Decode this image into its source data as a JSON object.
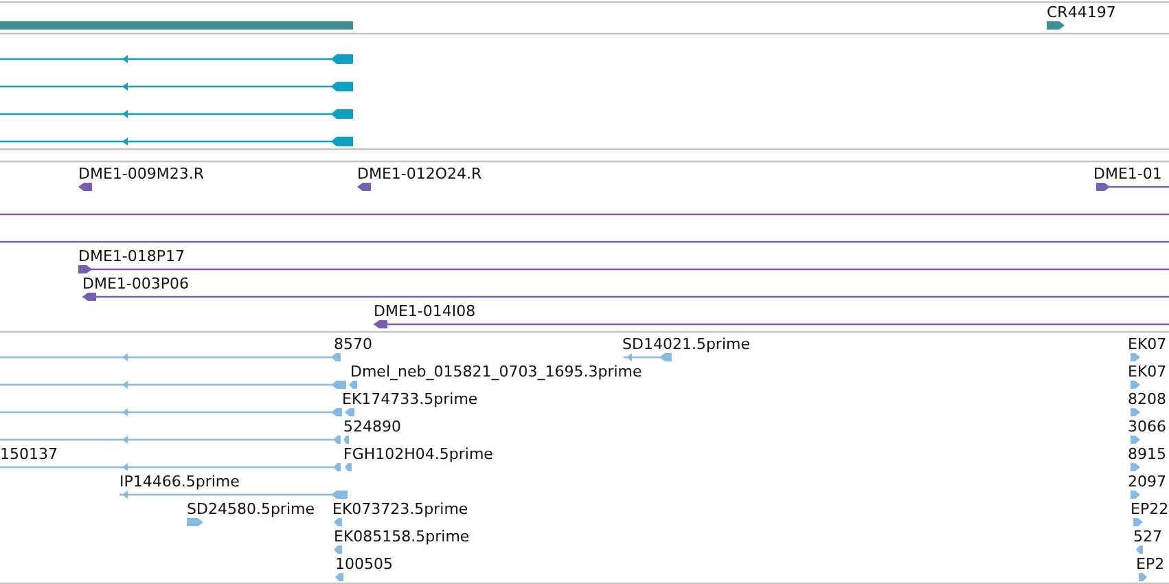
{
  "tracks": [
    {
      "color": "#3e8f92",
      "features": [
        {
          "kind": "bar"
        },
        {
          "label": "CR44197",
          "kind": "arrow",
          "reverse": false
        }
      ]
    },
    {
      "color": "#0fa0c6",
      "features": [
        {
          "kind": "arrow",
          "reverse": true
        },
        {
          "kind": "arrow",
          "reverse": true
        },
        {
          "kind": "arrow",
          "reverse": true
        },
        {
          "kind": "arrow",
          "reverse": true
        }
      ]
    },
    {
      "color": "#7a5cb0",
      "features": [
        {
          "label": "DME1-009M23.R",
          "kind": "arrow",
          "reverse": true
        },
        {
          "label": "DME1-012O24.R",
          "kind": "arrow",
          "reverse": true
        },
        {
          "label": "DME1-01",
          "kind": "arrow",
          "reverse": false
        },
        {
          "kind": "line"
        },
        {
          "kind": "line"
        },
        {
          "label": "DME1-018P17",
          "kind": "arrow",
          "reverse": false
        },
        {
          "label": "DME1-003P06",
          "kind": "arrow",
          "reverse": true
        },
        {
          "label": "DME1-014I08",
          "kind": "arrow",
          "reverse": true
        }
      ]
    },
    {
      "color": "#86bae0",
      "features": [
        {
          "label": "8570",
          "kind": "arrow",
          "reverse": true
        },
        {
          "label": "SD14021.5prime",
          "kind": "arrow",
          "reverse": true
        },
        {
          "label": "EK07",
          "kind": "arrow",
          "reverse": false
        },
        {
          "kind": "arrow",
          "reverse": true
        },
        {
          "label": "Dmel_neb_015821_0703_1695.3prime",
          "kind": "arrow",
          "reverse": true
        },
        {
          "label": "EK07",
          "kind": "arrow",
          "reverse": false
        },
        {
          "kind": "arrow",
          "reverse": true
        },
        {
          "label": "EK174733.5prime",
          "kind": "arrow",
          "reverse": true
        },
        {
          "label": "8208",
          "kind": "arrow",
          "reverse": false
        },
        {
          "kind": "arrow",
          "reverse": true
        },
        {
          "label": "524890",
          "kind": "arrow",
          "reverse": true
        },
        {
          "label": "3066",
          "kind": "arrow",
          "reverse": false
        },
        {
          "label": "150137",
          "kind": "arrow",
          "reverse": true
        },
        {
          "label": "FGH102H04.5prime",
          "kind": "arrow",
          "reverse": true
        },
        {
          "label": "8915",
          "kind": "arrow",
          "reverse": false
        },
        {
          "label": "IP14466.5prime",
          "kind": "arrow",
          "reverse": true
        },
        {
          "label": "2097",
          "kind": "arrow",
          "reverse": false
        },
        {
          "label": "SD24580.5prime",
          "kind": "arrow",
          "reverse": false
        },
        {
          "label": "EK073723.5prime",
          "kind": "arrow",
          "reverse": true
        },
        {
          "label": "EP22",
          "kind": "arrow",
          "reverse": false
        },
        {
          "label": "EK085158.5prime",
          "kind": "arrow",
          "reverse": true
        },
        {
          "label": "527",
          "kind": "arrow",
          "reverse": true
        },
        {
          "label": "100505",
          "kind": "arrow",
          "reverse": true
        },
        {
          "label": "EP2",
          "kind": "arrow",
          "reverse": false
        }
      ]
    }
  ]
}
